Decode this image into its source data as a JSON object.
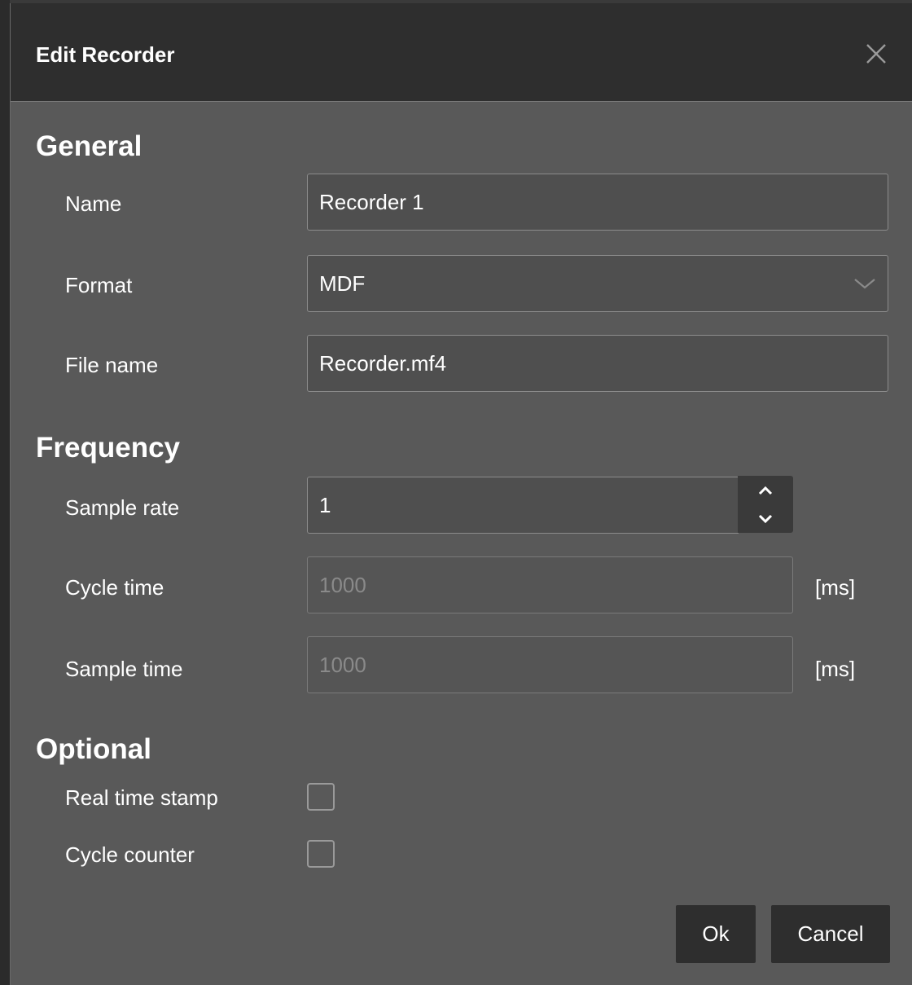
{
  "dialog": {
    "title": "Edit Recorder"
  },
  "general": {
    "heading": "General",
    "name_label": "Name",
    "name_value": "Recorder 1",
    "format_label": "Format",
    "format_value": "MDF",
    "filename_label": "File name",
    "filename_value": "Recorder.mf4"
  },
  "frequency": {
    "heading": "Frequency",
    "sample_rate_label": "Sample rate",
    "sample_rate_value": "1",
    "cycle_time_label": "Cycle time",
    "cycle_time_value": "1000",
    "cycle_time_unit": "[ms]",
    "sample_time_label": "Sample time",
    "sample_time_value": "1000",
    "sample_time_unit": "[ms]"
  },
  "optional": {
    "heading": "Optional",
    "real_time_stamp_label": "Real time stamp",
    "real_time_stamp_checked": false,
    "cycle_counter_label": "Cycle counter",
    "cycle_counter_checked": false
  },
  "buttons": {
    "ok": "Ok",
    "cancel": "Cancel"
  },
  "icons": {
    "close": "close-icon",
    "dropdown": "chevron-down-icon",
    "step_up": "chevron-up-icon",
    "step_down": "chevron-down-icon"
  }
}
